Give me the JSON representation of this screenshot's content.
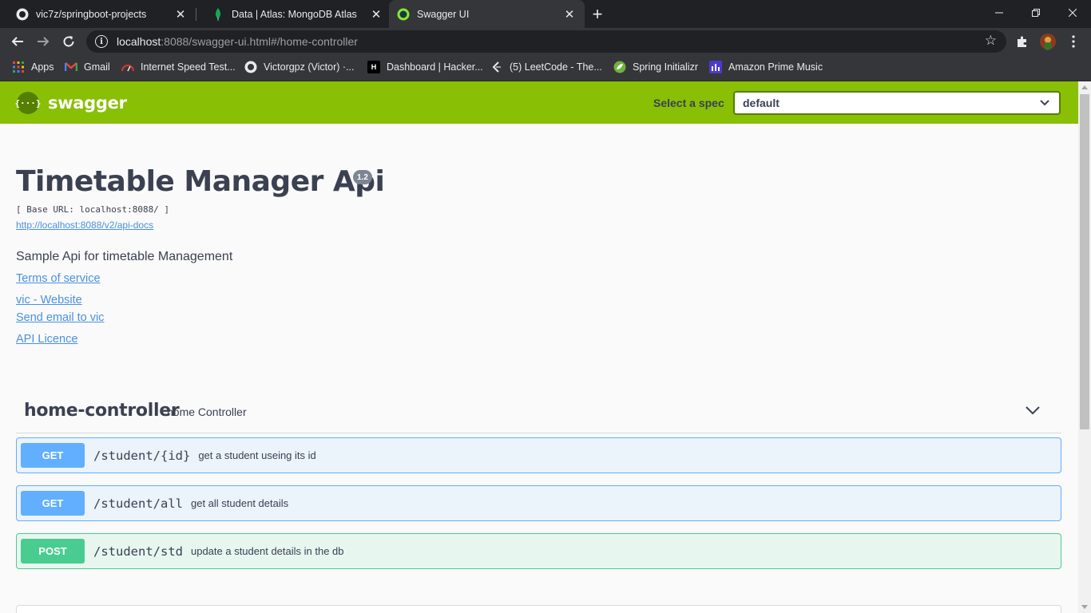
{
  "browser": {
    "tabs": [
      {
        "title": "vic7z/springboot-projects",
        "icon": "github-icon"
      },
      {
        "title": "Data | Atlas: MongoDB Atlas",
        "icon": "mongodb-leaf-icon"
      },
      {
        "title": "Swagger UI",
        "icon": "swagger-icon"
      }
    ],
    "url_host": "localhost",
    "url_rest": ":8088/swagger-ui.html#/home-controller",
    "bookmarks": [
      {
        "label": "Apps",
        "icon": "apps-grid-icon"
      },
      {
        "label": "Gmail",
        "icon": "gmail-icon"
      },
      {
        "label": "Internet Speed Test...",
        "icon": "speedometer-icon"
      },
      {
        "label": "Victorgpz (Victor) ·...",
        "icon": "github-icon"
      },
      {
        "label": "Dashboard | Hacker...",
        "icon": "hackerrank-icon"
      },
      {
        "label": "(5) LeetCode - The...",
        "icon": "leetcode-icon"
      },
      {
        "label": "Spring Initializr",
        "icon": "spring-icon"
      },
      {
        "label": "Amazon Prime Music",
        "icon": "prime-music-icon"
      }
    ]
  },
  "topbar": {
    "logo_text": "swagger",
    "spec_label": "Select a spec",
    "spec_value": "default"
  },
  "info": {
    "title": "Timetable Manager Api",
    "version": "1.2",
    "base_url": "[ Base URL: localhost:8088/ ]",
    "docs_link": "http://localhost:8088/v2/api-docs",
    "description": "Sample Api for timetable Management",
    "terms": "Terms of service",
    "website": "vic - Website",
    "email": "Send email to vic",
    "licence": "API Licence"
  },
  "controller": {
    "name": "home-controller",
    "description": "home Controller",
    "operations": [
      {
        "method": "GET",
        "path": "/student/{id}",
        "summary": "get a student useing its id"
      },
      {
        "method": "GET",
        "path": "/student/all",
        "summary": "get all student details"
      },
      {
        "method": "POST",
        "path": "/student/std",
        "summary": "update a student details in the db"
      }
    ]
  },
  "colors": {
    "swagger_green": "#89bf04",
    "get_blue": "#61affe",
    "post_green": "#49cc90",
    "link_blue": "#4990e2",
    "text_dark": "#3b4151"
  }
}
